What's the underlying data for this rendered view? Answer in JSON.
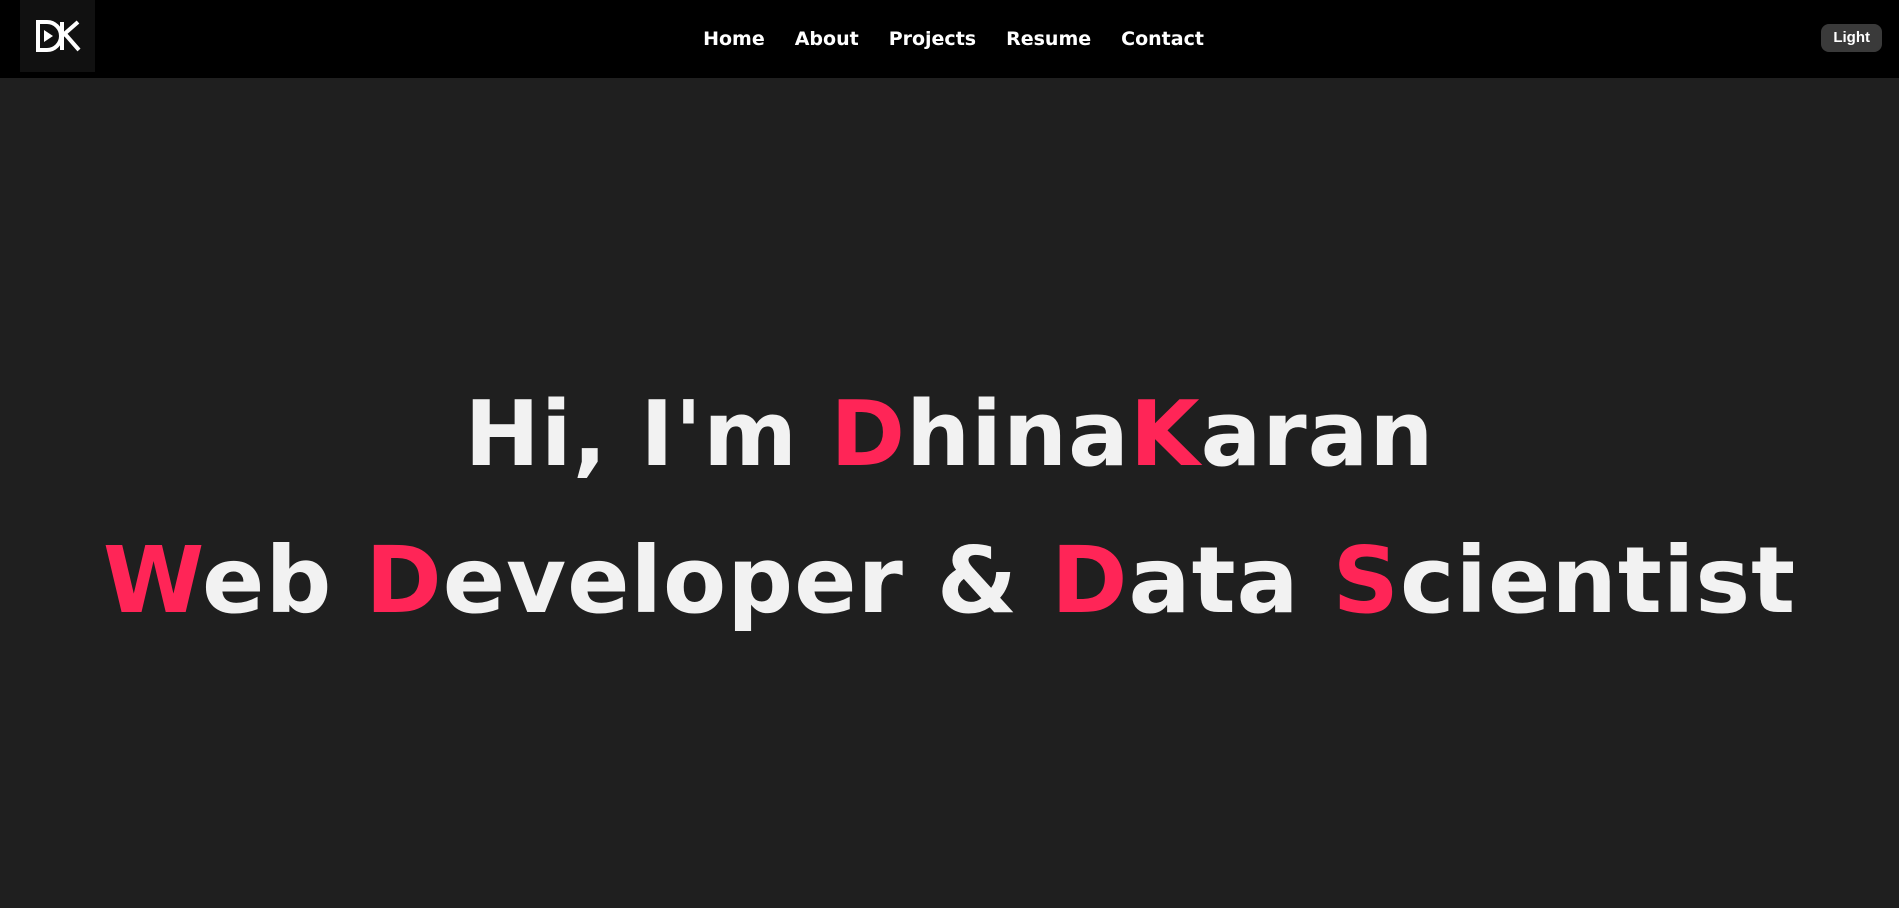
{
  "navbar": {
    "logo_text": "DK",
    "links": [
      "Home",
      "About",
      "Projects",
      "Resume",
      "Contact"
    ],
    "theme_toggle_label": "Light"
  },
  "hero": {
    "line1": [
      {
        "text": "Hi, I'm ",
        "accent": false
      },
      {
        "text": "D",
        "accent": true
      },
      {
        "text": "hina",
        "accent": false
      },
      {
        "text": "K",
        "accent": true
      },
      {
        "text": "aran",
        "accent": false
      }
    ],
    "line2": [
      {
        "text": "W",
        "accent": true
      },
      {
        "text": "eb ",
        "accent": false
      },
      {
        "text": "D",
        "accent": true
      },
      {
        "text": "eveloper & ",
        "accent": false
      },
      {
        "text": "D",
        "accent": true
      },
      {
        "text": "ata ",
        "accent": false
      },
      {
        "text": "S",
        "accent": true
      },
      {
        "text": "cientist",
        "accent": false
      }
    ]
  },
  "colors": {
    "accent": "#ff2557",
    "background": "#1f1f1f",
    "navbar": "#000000",
    "text": "#f2f2f2"
  }
}
